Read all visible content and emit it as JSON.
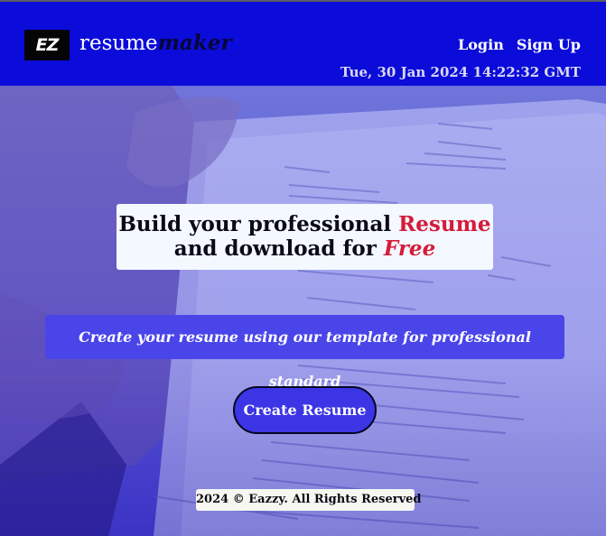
{
  "header": {
    "logo_text": "EZ",
    "brand_primary": "resume",
    "brand_secondary": "maker",
    "nav": {
      "login": "Login",
      "signup": "Sign Up"
    },
    "datetime": "Tue, 30 Jan 2024 14:22:32 GMT"
  },
  "hero": {
    "headline_line1_a": "Build your professional ",
    "headline_line1_b": "Resume",
    "headline_line2_a": "and download for ",
    "headline_line2_b": "Free",
    "tagline": "Create your resume using our template for professional standard",
    "cta_label": "Create Resume"
  },
  "footer": {
    "text": "2024 © Eazzy. All Rights Reserved"
  },
  "colors": {
    "header_bg": "#0c0cda",
    "accent_red": "#d41b3a",
    "tagline_bg": "#4a45e9",
    "button_bg": "#3b35e6"
  }
}
